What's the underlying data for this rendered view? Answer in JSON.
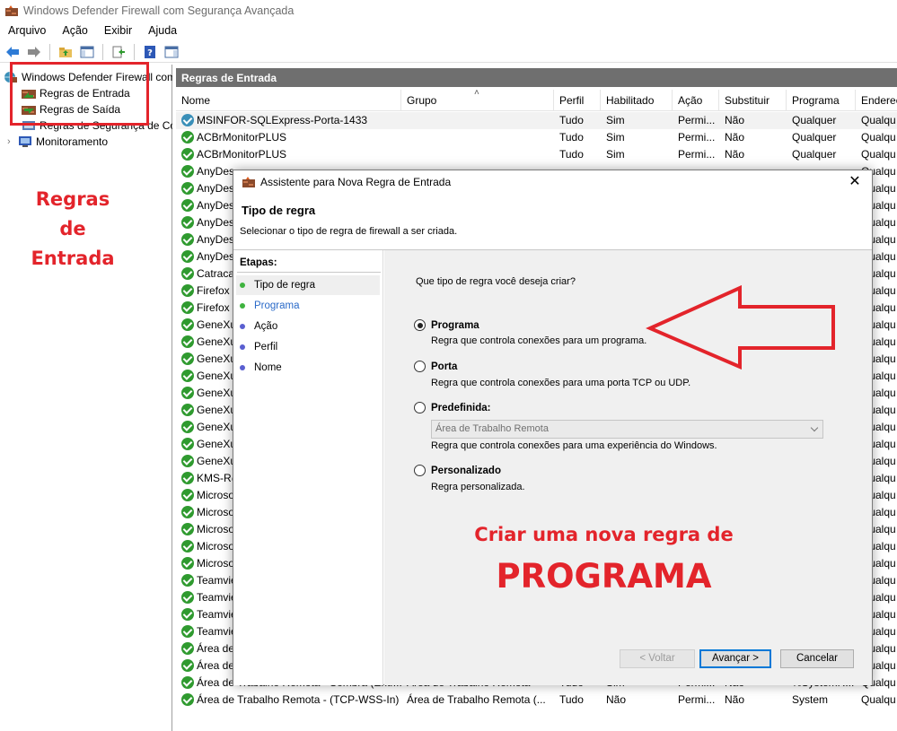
{
  "window": {
    "title": "Windows Defender Firewall com Segurança Avançada"
  },
  "menu": [
    "Arquivo",
    "Ação",
    "Exibir",
    "Ajuda"
  ],
  "tree": {
    "root": "Windows Defender Firewall com Segurança Avançada",
    "inbound": "Regras de Entrada",
    "outbound": "Regras de Saída",
    "connection_security": "Regras de Segurança de Conexão",
    "monitoring": "Monitoramento"
  },
  "pane": {
    "title": "Regras de Entrada",
    "columns": [
      "Nome",
      "Grupo",
      "Perfil",
      "Habilitado",
      "Ação",
      "Substituir",
      "Programa",
      "Endereço"
    ],
    "rows": [
      [
        "MSINFOR-SQLExpress-Porta-1433",
        "",
        "Tudo",
        "Sim",
        "Permi...",
        "Não",
        "Qualquer",
        "Qualqu"
      ],
      [
        "ACBrMonitorPLUS",
        "",
        "Tudo",
        "Sim",
        "Permi...",
        "Não",
        "Qualquer",
        "Qualqu"
      ],
      [
        "ACBrMonitorPLUS",
        "",
        "Tudo",
        "Sim",
        "Permi...",
        "Não",
        "Qualquer",
        "Qualqu"
      ],
      [
        "AnyDes",
        "",
        "",
        "",
        "",
        "",
        "",
        "Qualqu"
      ],
      [
        "AnyDes",
        "",
        "",
        "",
        "",
        "",
        "",
        "Qualqu"
      ],
      [
        "AnyDes",
        "",
        "",
        "",
        "",
        "",
        "",
        "Qualqu"
      ],
      [
        "AnyDes",
        "",
        "",
        "",
        "",
        "",
        "",
        "Qualqu"
      ],
      [
        "AnyDes",
        "",
        "",
        "",
        "",
        "",
        "",
        "Qualqu"
      ],
      [
        "AnyDes",
        "",
        "",
        "",
        "",
        "",
        "",
        "Qualqu"
      ],
      [
        "Catraca",
        "",
        "",
        "",
        "",
        "",
        "",
        "Qualqu"
      ],
      [
        "Firefox (",
        "",
        "",
        "",
        "",
        "",
        "",
        "Qualqu"
      ],
      [
        "Firefox (",
        "",
        "",
        "",
        "",
        "",
        "",
        "Qualqu"
      ],
      [
        "GeneXu",
        "",
        "",
        "",
        "",
        "",
        "",
        "Qualqu"
      ],
      [
        "GeneXu",
        "",
        "",
        "",
        "",
        "",
        "",
        "Qualqu"
      ],
      [
        "GeneXu",
        "",
        "",
        "",
        "",
        "",
        "",
        "Qualqu"
      ],
      [
        "GeneXu",
        "",
        "",
        "",
        "",
        "",
        "",
        "Qualqu"
      ],
      [
        "GeneXu",
        "",
        "",
        "",
        "",
        "",
        "",
        "Qualqu"
      ],
      [
        "GeneXu",
        "",
        "",
        "",
        "",
        "",
        "",
        "Qualqu"
      ],
      [
        "GeneXu",
        "",
        "",
        "",
        "",
        "",
        "",
        "Qualqu"
      ],
      [
        "GeneXu",
        "",
        "",
        "",
        "",
        "",
        "",
        "Qualqu"
      ],
      [
        "GeneXu",
        "",
        "",
        "",
        "",
        "",
        "",
        "Qualqu"
      ],
      [
        "KMS-R@",
        "",
        "",
        "",
        "",
        "",
        "",
        "Qualqu"
      ],
      [
        "Microso",
        "",
        "",
        "",
        "",
        "",
        "",
        "Qualqu"
      ],
      [
        "Microso",
        "",
        "",
        "",
        "",
        "",
        "",
        "Qualqu"
      ],
      [
        "Microso",
        "",
        "",
        "",
        "",
        "",
        "",
        "Qualqu"
      ],
      [
        "Microso",
        "",
        "",
        "",
        "",
        "",
        "",
        "Qualqu"
      ],
      [
        "Microso",
        "",
        "",
        "",
        "",
        "",
        "",
        "Qualqu"
      ],
      [
        "Teamvie",
        "",
        "",
        "",
        "",
        "",
        "",
        "Qualqu"
      ],
      [
        "Teamvie",
        "",
        "",
        "",
        "",
        "",
        "",
        "Qualqu"
      ],
      [
        "Teamvie",
        "",
        "",
        "",
        "",
        "",
        "",
        "Qualqu"
      ],
      [
        "Teamvie",
        "",
        "",
        "",
        "",
        "",
        "",
        "Qualqu"
      ],
      [
        "Área de",
        "",
        "",
        "",
        "",
        "",
        "",
        "Qualqu"
      ],
      [
        "Área de",
        "",
        "",
        "",
        "",
        "",
        "",
        "Qualqu"
      ],
      [
        "Área de Trabalho Remota - Sombra (Entr...",
        "Área de Trabalho Remota",
        "Tudo",
        "Sim",
        "Permi...",
        "Não",
        "%SystemR...",
        "Qualqu"
      ],
      [
        "Área de Trabalho Remota - (TCP-WSS-In)",
        "Área de Trabalho Remota (...",
        "Tudo",
        "Não",
        "Permi...",
        "Não",
        "System",
        "Qualqu"
      ]
    ]
  },
  "dialog": {
    "title": "Assistente para Nova Regra de Entrada",
    "heading": "Tipo de regra",
    "subheading": "Selecionar o tipo de regra de firewall a ser criada.",
    "steps_title": "Etapas:",
    "steps": [
      "Tipo de regra",
      "Programa",
      "Ação",
      "Perfil",
      "Nome"
    ],
    "question": "Que tipo de regra você deseja criar?",
    "options": [
      {
        "label": "Programa",
        "desc": "Regra que controla conexões para um programa.",
        "selected": true
      },
      {
        "label": "Porta",
        "desc": "Regra que controla conexões para uma porta TCP ou UDP.",
        "selected": false
      },
      {
        "label": "Predefinida:",
        "desc": "Regra que controla conexões para uma experiência do Windows.",
        "selected": false
      },
      {
        "label": "Personalizado",
        "desc": "Regra personalizada.",
        "selected": false
      }
    ],
    "predefined_select": "Área de Trabalho Remota",
    "buttons": {
      "back": "< Voltar",
      "next": "Avançar >",
      "cancel": "Cancelar"
    }
  },
  "annotations": {
    "left_line1": "Regras",
    "left_line2": "de",
    "left_line3": "Entrada",
    "center_line1": "Criar uma nova regra de",
    "center_line2": "PROGRAMA"
  },
  "colors": {
    "accent_red": "#e3242b",
    "header_gray": "#6f6f6f",
    "check_green": "#2f9a2f",
    "focus_blue": "#0078d7"
  }
}
